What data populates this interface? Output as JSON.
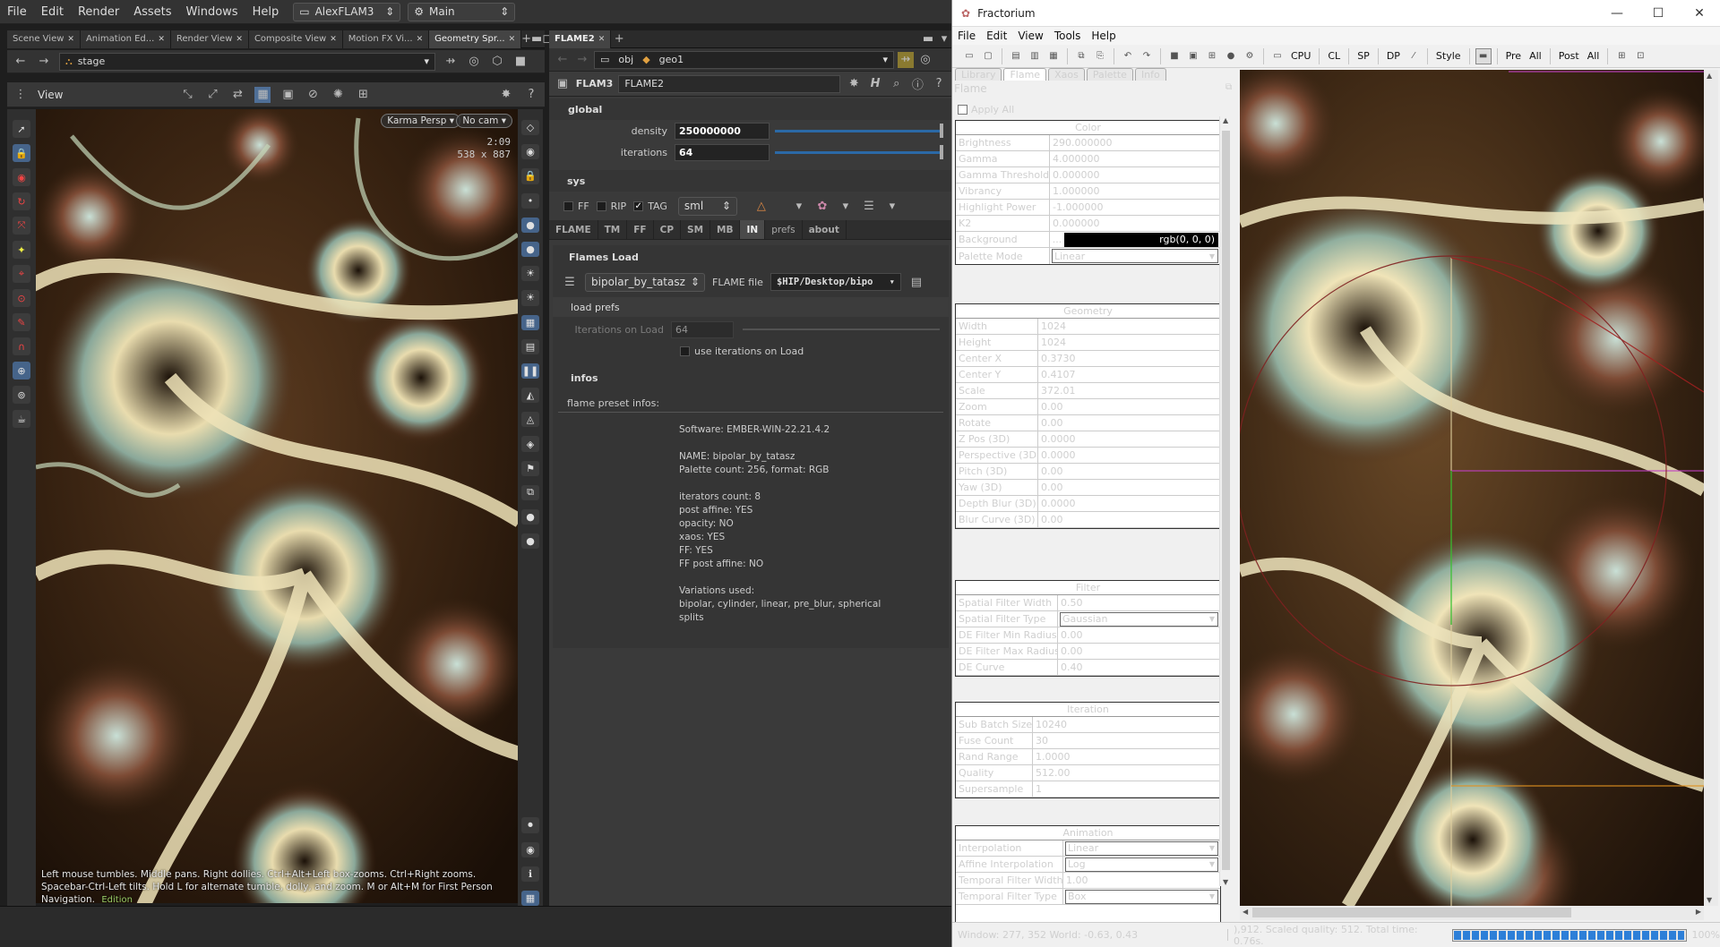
{
  "houdini": {
    "menu": [
      "File",
      "Edit",
      "Render",
      "Assets",
      "Windows",
      "Help"
    ],
    "desktop": "AlexFLAM3",
    "workspace": "Main",
    "pane_tabs": [
      "Scene View",
      "Animation Ed...",
      "Render View",
      "Composite View",
      "Motion FX Vi...",
      "Geometry Spr..."
    ],
    "stage_path": "stage",
    "view_label": "View",
    "camera_menu": "Karma Persp",
    "no_cam": "No cam",
    "viewport_time": "2:09",
    "viewport_res": "538 x 887",
    "status_line": "Left mouse tumbles. Middle pans. Right dollies. Ctrl+Alt+Left box-zooms. Ctrl+Right zooms. Spacebar-Ctrl-Left tilts. Hold L for alternate tumble, dolly, and zoom.    M or Alt+M for First Person Navigation.",
    "edition_tag": "Edition",
    "net_tab": "FLAME2",
    "net_path": [
      "obj",
      "geo1"
    ],
    "node_type": "FLAM3",
    "node_name": "FLAME2",
    "global_label": "global",
    "density_label": "density",
    "density": "250000000",
    "iterations_label": "iterations",
    "iterations": "64",
    "sys_label": "sys",
    "ff_label": "FF",
    "rip_label": "RIP",
    "tag_label": "TAG",
    "sml": "sml",
    "tabs": [
      "FLAME",
      "TM",
      "FF",
      "CP",
      "SM",
      "MB",
      "IN",
      "prefs",
      "about"
    ],
    "active_tab": "IN",
    "flames_load": "Flames Load",
    "preset": "bipolar_by_tatasz",
    "flame_file_label": "FLAME file",
    "flame_file": "$HIP/Desktop/bipo",
    "load_prefs": "load prefs",
    "iter_on_load_label": "Iterations on Load",
    "iter_on_load": "64",
    "use_iter_label": "use iterations on Load",
    "infos_label": "infos",
    "preset_infos_label": "flame preset infos:",
    "infos": [
      "Software: EMBER-WIN-22.21.4.2",
      "",
      "NAME: bipolar_by_tatasz",
      "Palette count: 256, format: RGB",
      "",
      "iterators count: 8",
      "post affine: YES",
      "opacity: NO",
      "xaos: YES",
      "FF: YES",
      "FF post affine: NO",
      "",
      "Variations used:",
      "bipolar, cylinder, linear, pre_blur, spherical",
      "splits"
    ]
  },
  "fractorium": {
    "title": "Fractorium",
    "menu": [
      "File",
      "Edit",
      "View",
      "Tools",
      "Help"
    ],
    "toolbar_text": [
      "CPU",
      "CL",
      "SP",
      "DP",
      "Style",
      "Pre",
      "All",
      "Post",
      "All"
    ],
    "tabs": [
      "Library",
      "Flame",
      "Xaos",
      "Palette",
      "Info"
    ],
    "active_tab": "Flame",
    "panel_title": "Flame",
    "apply_all": "Apply All",
    "color": {
      "title": "Color",
      "rows": [
        [
          "Brightness",
          "290.000000"
        ],
        [
          "Gamma",
          "4.000000"
        ],
        [
          "Gamma Threshold",
          "0.000000"
        ],
        [
          "Vibrancy",
          "1.000000"
        ],
        [
          "Highlight Power",
          "-1.000000"
        ],
        [
          "K2",
          "0.000000"
        ]
      ],
      "bg_label": "Background",
      "bg_btn": "...",
      "bg_value": "rgb(0, 0, 0)",
      "palette_label": "Palette Mode",
      "palette_value": "Linear"
    },
    "geometry": {
      "title": "Geometry",
      "rows": [
        [
          "Width",
          "1024"
        ],
        [
          "Height",
          "1024"
        ],
        [
          "Center X",
          "0.3730"
        ],
        [
          "Center Y",
          "0.4107"
        ],
        [
          "Scale",
          "372.01"
        ],
        [
          "Zoom",
          "0.00"
        ],
        [
          "Rotate",
          "0.00"
        ],
        [
          "Z Pos (3D)",
          "0.0000"
        ],
        [
          "Perspective (3D)",
          "0.0000"
        ],
        [
          "Pitch (3D)",
          "0.00"
        ],
        [
          "Yaw (3D)",
          "0.00"
        ],
        [
          "Depth Blur (3D)",
          "0.0000"
        ],
        [
          "Blur Curve (3D)",
          "0.00"
        ]
      ]
    },
    "filter": {
      "title": "Filter",
      "sw_label": "Spatial Filter Width",
      "sw": "0.50",
      "st_label": "Spatial Filter Type",
      "st": "Gaussian",
      "rows": [
        [
          "DE Filter Min Radius",
          "0.00"
        ],
        [
          "DE Filter Max Radius",
          "0.00"
        ],
        [
          "DE Curve",
          "0.40"
        ]
      ]
    },
    "iteration": {
      "title": "Iteration",
      "rows": [
        [
          "Sub Batch Size",
          "10240"
        ],
        [
          "Fuse Count",
          "30"
        ],
        [
          "Rand Range",
          "1.0000"
        ],
        [
          "Quality",
          "512.00"
        ],
        [
          "Supersample",
          "1"
        ]
      ]
    },
    "animation": {
      "title": "Animation",
      "interp_label": "Interpolation",
      "interp": "Linear",
      "affine_label": "Affine Interpolation",
      "affine": "Log",
      "tfw_label": "Temporal Filter Width",
      "tfw": "1.00",
      "tft_label": "Temporal Filter Type",
      "tft": "Box"
    },
    "status_left": "Window:  277,  352 World: -0.63, 0.43",
    "status_mid": "),912. Scaled quality: 512. Total time: 0.76s.",
    "progress": 1.0,
    "zoom": "100%"
  }
}
